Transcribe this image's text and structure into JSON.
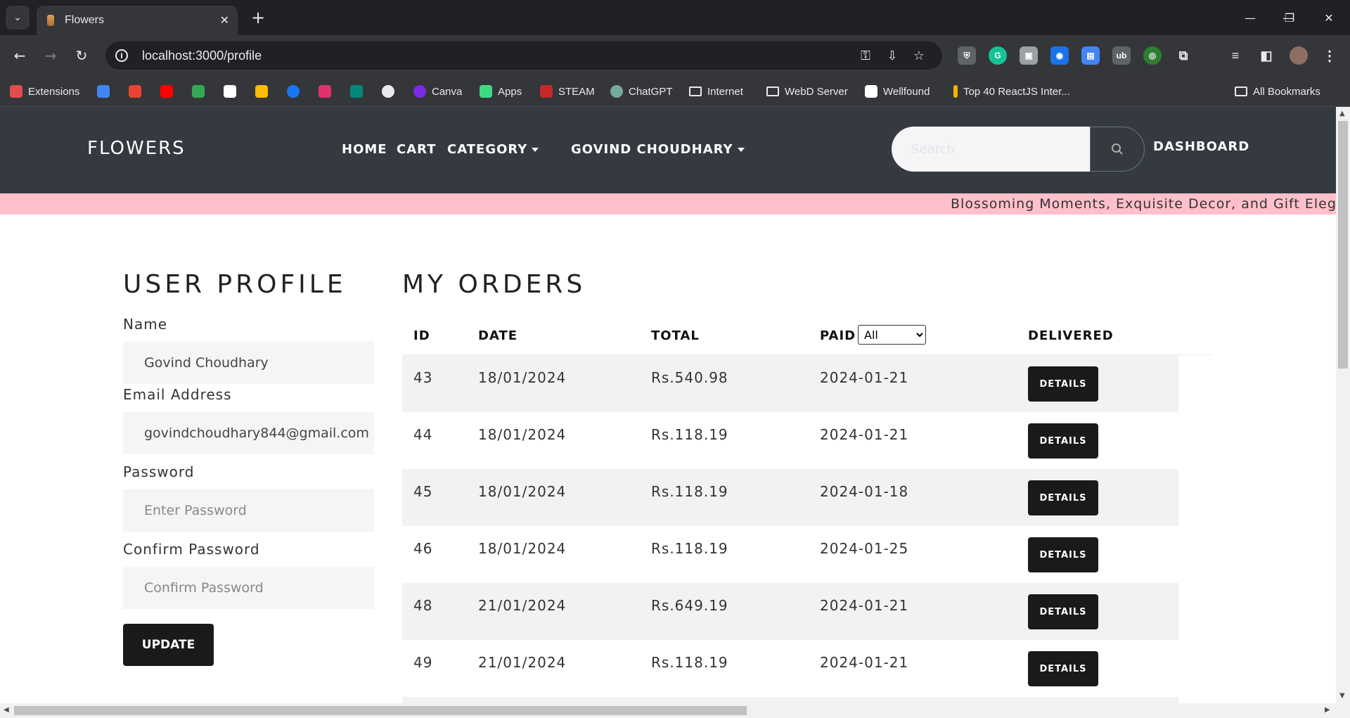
{
  "browser": {
    "tab_title": "Flowers",
    "tab_close": "✕",
    "new_tab": "+",
    "url": "localhost:3000/profile",
    "window_controls": [
      "—",
      "❐",
      "✕"
    ]
  },
  "bookmarks": [
    {
      "label": "Extensions",
      "color": "#e34c4c"
    },
    {
      "label": "",
      "color": "#4285f4"
    },
    {
      "label": "",
      "color": "#ea4335"
    },
    {
      "label": "",
      "color": "#ff0000"
    },
    {
      "label": "",
      "color": "#34a853"
    },
    {
      "label": "",
      "color": "#ffffff"
    },
    {
      "label": "",
      "color": "#fbbc05"
    },
    {
      "label": "",
      "color": "#1877f2"
    },
    {
      "label": "",
      "color": "#e1306c"
    },
    {
      "label": "",
      "color": "#00897b"
    },
    {
      "label": "",
      "color": "#e8eaed"
    },
    {
      "label": "Canva",
      "color": "#7d2ae8"
    },
    {
      "label": "Apps",
      "color": "#3ddc84"
    },
    {
      "label": "STEAM",
      "color": "#c62828"
    },
    {
      "label": "ChatGPT",
      "color": "#74aa9c"
    },
    {
      "label": "Internet",
      "folder": true
    },
    {
      "label": "WebD Server",
      "folder": true
    },
    {
      "label": "Wellfound",
      "color": "#ffffff"
    },
    {
      "label": "Top 40 ReactJS Inter...",
      "color": "#f4b400"
    },
    {
      "label": "All Bookmarks",
      "folder": true
    }
  ],
  "navbar": {
    "brand": "FLOWERS",
    "links": [
      "HOME",
      "CART",
      "CATEGORY",
      "GOVIND CHOUDHARY"
    ],
    "search_placeholder": "Search",
    "dashboard": "DASHBOARD"
  },
  "marquee": "Blossoming Moments, Exquisite Decor, and Gift Elegan",
  "profile": {
    "title": "USER PROFILE",
    "name_label": "Name",
    "name_value": "Govind Choudhary",
    "email_label": "Email Address",
    "email_value": "govindchoudhary844@gmail.com",
    "password_label": "Password",
    "password_placeholder": "Enter Password",
    "confirm_label": "Confirm Password",
    "confirm_placeholder": "Confirm Password",
    "update_button": "UPDATE"
  },
  "orders": {
    "title": "MY ORDERS",
    "headers": {
      "id": "ID",
      "date": "DATE",
      "total": "TOTAL",
      "paid": "PAID",
      "delivered": "DELIVERED"
    },
    "paid_filter": "All",
    "details_label": "DETAILS",
    "rows": [
      {
        "id": "43",
        "date": "18/01/2024",
        "total": "Rs.540.98",
        "paid": "2024-01-21"
      },
      {
        "id": "44",
        "date": "18/01/2024",
        "total": "Rs.118.19",
        "paid": "2024-01-21"
      },
      {
        "id": "45",
        "date": "18/01/2024",
        "total": "Rs.118.19",
        "paid": "2024-01-18"
      },
      {
        "id": "46",
        "date": "18/01/2024",
        "total": "Rs.118.19",
        "paid": "2024-01-25"
      },
      {
        "id": "48",
        "date": "21/01/2024",
        "total": "Rs.649.19",
        "paid": "2024-01-21"
      },
      {
        "id": "49",
        "date": "21/01/2024",
        "total": "Rs.118.19",
        "paid": "2024-01-21"
      }
    ]
  }
}
